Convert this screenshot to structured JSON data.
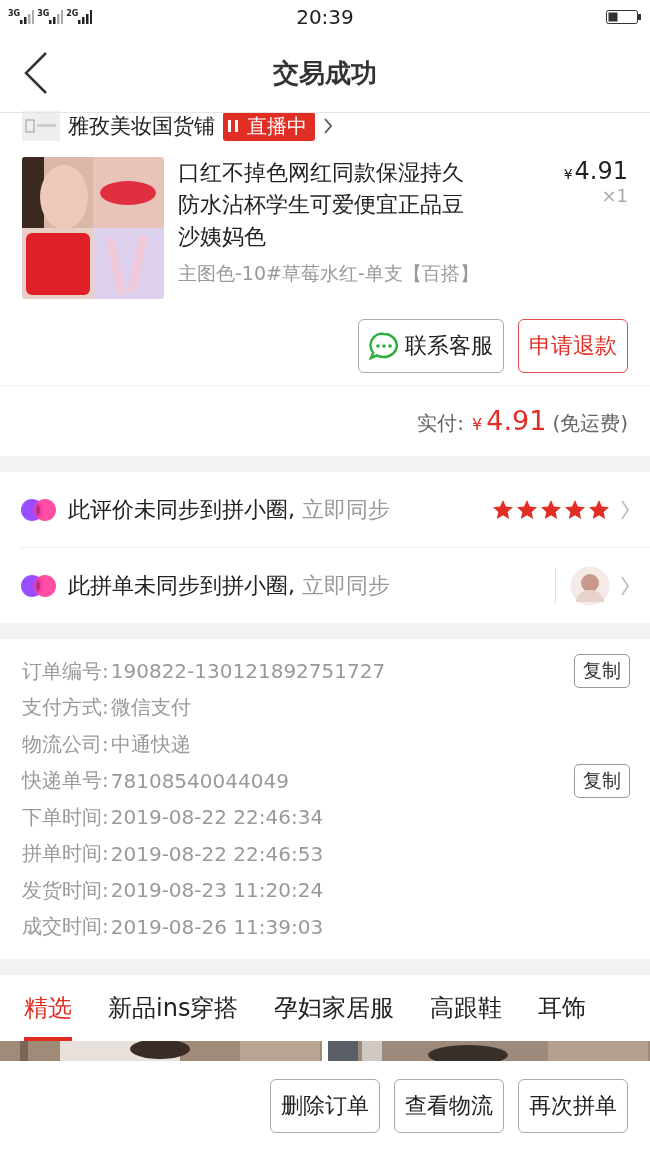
{
  "status_bar": {
    "network": "3G 3G 2G",
    "time": "20:39"
  },
  "nav": {
    "title": "交易成功"
  },
  "store": {
    "name": "雅孜美妆国货铺",
    "badge": "直播中"
  },
  "product": {
    "title": "口红不掉色网红同款保湿持久防水沾杯学生可爱便宜正品豆沙姨妈色",
    "variant": "主图色-10#草莓水红-单支【百搭】",
    "price": "4.91",
    "currency": "¥",
    "quantity": "×1"
  },
  "product_actions": [
    {
      "label": "联系客服",
      "kind": "chat"
    },
    {
      "label": "申请退款",
      "kind": "primary"
    }
  ],
  "total": {
    "label": "实付:",
    "currency": "¥",
    "amount": "4.91",
    "note": "(免运费)"
  },
  "sync_rows": [
    {
      "text": "此评价未同步到拼小圈,",
      "action": "立即同步",
      "kind": "rating",
      "stars": 5
    },
    {
      "text": "此拼单未同步到拼小圈,",
      "action": "立即同步",
      "kind": "avatar"
    }
  ],
  "order_info": [
    {
      "label": "订单编号:",
      "value": "190822-130121892751727",
      "action": "复制"
    },
    {
      "label": "支付方式:",
      "value": "微信支付"
    },
    {
      "label": "物流公司:",
      "value": "中通快递"
    },
    {
      "label": "快递单号:",
      "value": "78108540044049",
      "action": "复制"
    },
    {
      "label": "下单时间:",
      "value": "2019-08-22 22:46:34"
    },
    {
      "label": "拼单时间:",
      "value": "2019-08-22 22:46:53"
    },
    {
      "label": "发货时间:",
      "value": "2019-08-23 11:20:24"
    },
    {
      "label": "成交时间:",
      "value": "2019-08-26 11:39:03"
    }
  ],
  "category_tabs": [
    {
      "label": "精选",
      "selected": true
    },
    {
      "label": "新品ins穿搭",
      "selected": false
    },
    {
      "label": "孕妇家居服",
      "selected": false
    },
    {
      "label": "高跟鞋",
      "selected": false
    },
    {
      "label": "耳饰",
      "selected": false
    }
  ],
  "bottom_actions": [
    "删除订单",
    "查看物流",
    "再次拼单"
  ]
}
